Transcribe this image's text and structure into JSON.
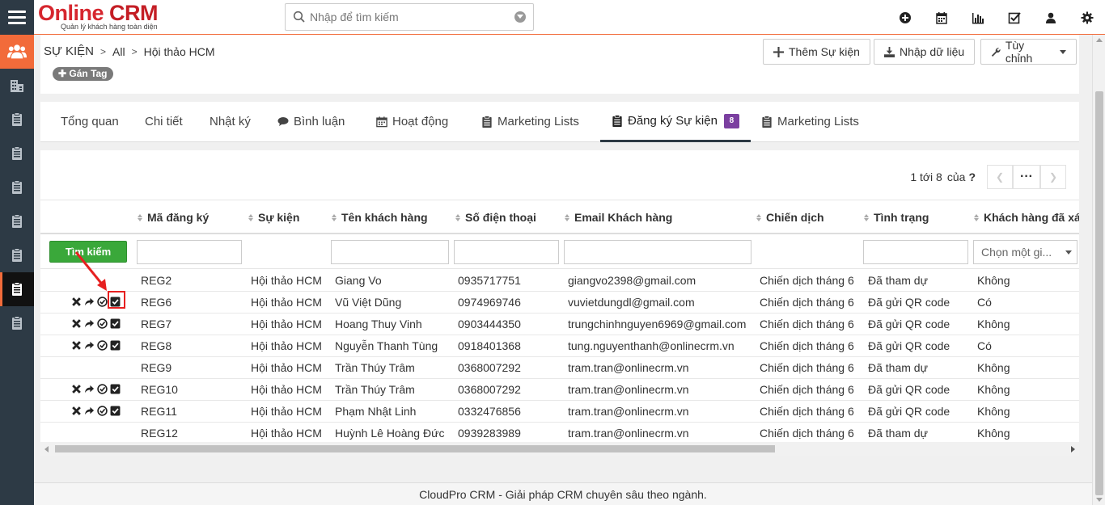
{
  "app": {
    "logo_main": "Online CRM",
    "logo_sub": "Quản lý khách hàng toàn diện"
  },
  "search": {
    "placeholder": "Nhập để tìm kiếm"
  },
  "top_icons": [
    "plus-circle-icon",
    "calendar-icon",
    "bar-chart-icon",
    "checkbox-icon",
    "user-icon",
    "gear-icon"
  ],
  "breadcrumb": {
    "module": "SỰ KIỆN",
    "filter": "All",
    "record": "Hội thảo HCM"
  },
  "tag_button": "Gán Tag",
  "header_buttons": {
    "add": "Thêm Sự kiện",
    "import": "Nhập dữ liệu",
    "customize": "Tùy chỉnh"
  },
  "tabs": [
    {
      "label": "Tổng quan"
    },
    {
      "label": "Chi tiết"
    },
    {
      "label": "Nhật ký"
    },
    {
      "label": "Bình luận"
    },
    {
      "label": "Hoạt động"
    },
    {
      "label": "Marketing Lists"
    },
    {
      "label": "Đăng ký Sự kiện",
      "badge": "8"
    },
    {
      "label": "Marketing Lists"
    }
  ],
  "pager": {
    "range": "1 tới 8",
    "of": "của",
    "total": "?",
    "more": "···"
  },
  "columns": [
    "Mã đăng ký",
    "Sự kiện",
    "Tên khách hàng",
    "Số điện thoại",
    "Email Khách hàng",
    "Chiến dịch",
    "Tình trạng",
    "Khách hàng đã xác"
  ],
  "filter": {
    "search_button": "Tìm kiếm",
    "select_placeholder": "Chọn một gi..."
  },
  "rows": [
    {
      "code": "REG2",
      "event": "Hội thảo HCM",
      "customer": "Giang Vo",
      "phone": "0935717751",
      "email": "giangvo2398@gmail.com",
      "campaign": "Chiến dịch tháng 6",
      "status": "Đã tham dự",
      "confirmed": "Không",
      "actions": false
    },
    {
      "code": "REG6",
      "event": "Hội thảo HCM",
      "customer": "Vũ Việt Dũng",
      "phone": "0974969746",
      "email": "vuvietdungdl@gmail.com",
      "campaign": "Chiến dịch tháng 6",
      "status": "Đã gửi QR code",
      "confirmed": "Có",
      "actions": true
    },
    {
      "code": "REG7",
      "event": "Hội thảo HCM",
      "customer": "Hoang Thuy Vinh",
      "phone": "0903444350",
      "email": "trungchinhnguyen6969@gmail.com",
      "campaign": "Chiến dịch tháng 6",
      "status": "Đã gửi QR code",
      "confirmed": "Không",
      "actions": true
    },
    {
      "code": "REG8",
      "event": "Hội thảo HCM",
      "customer": "Nguyễn Thanh Tùng",
      "phone": "0918401368",
      "email": "tung.nguyenthanh@onlinecrm.vn",
      "campaign": "Chiến dịch tháng 6",
      "status": "Đã gửi QR code",
      "confirmed": "Có",
      "actions": true
    },
    {
      "code": "REG9",
      "event": "Hội thảo HCM",
      "customer": "Trần Thúy Trâm",
      "phone": "0368007292",
      "email": "tram.tran@onlinecrm.vn",
      "campaign": "Chiến dịch tháng 6",
      "status": "Đã tham dự",
      "confirmed": "Không",
      "actions": false
    },
    {
      "code": "REG10",
      "event": "Hội thảo HCM",
      "customer": "Trần Thúy Trâm",
      "phone": "0368007292",
      "email": "tram.tran@onlinecrm.vn",
      "campaign": "Chiến dịch tháng 6",
      "status": "Đã gửi QR code",
      "confirmed": "Không",
      "actions": true
    },
    {
      "code": "REG11",
      "event": "Hội thảo HCM",
      "customer": "Phạm Nhật Linh",
      "phone": "0332476856",
      "email": "tram.tran@onlinecrm.vn",
      "campaign": "Chiến dịch tháng 6",
      "status": "Đã gửi QR code",
      "confirmed": "Không",
      "actions": true
    },
    {
      "code": "REG12",
      "event": "Hội thảo HCM",
      "customer": "Huỳnh Lê Hoàng Đức",
      "phone": "0939283989",
      "email": "tram.tran@onlinecrm.vn",
      "campaign": "Chiến dịch tháng 6",
      "status": "Đã tham dự",
      "confirmed": "Không",
      "actions": false
    }
  ],
  "footer": "CloudPro CRM - Giải pháp CRM chuyên sâu theo ngành.",
  "colors": {
    "accent": "#f26b3a",
    "sidebar": "#2d3a45",
    "badge": "#7b3fa0",
    "search_button": "#3aa83a",
    "annotation": "#e62020"
  }
}
